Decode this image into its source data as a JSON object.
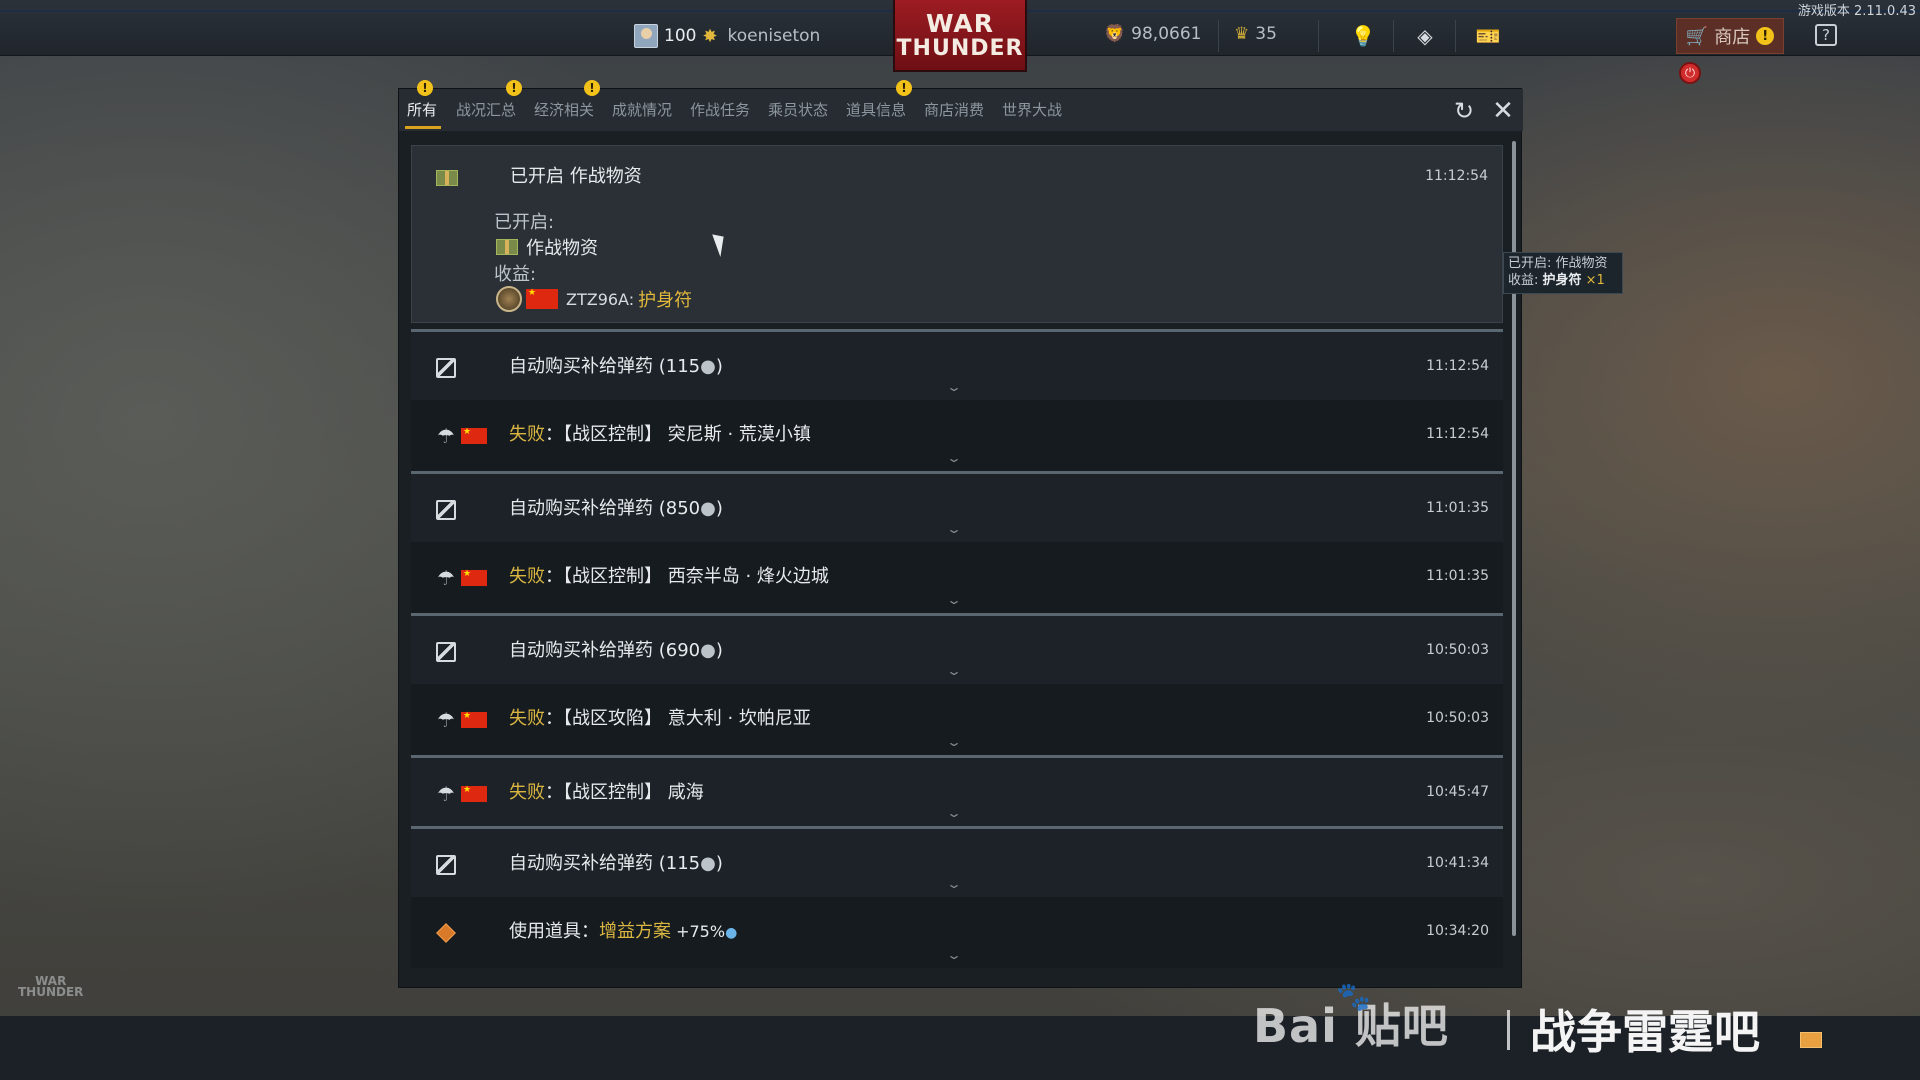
{
  "version_text": "游戏版本 2.11.0.43",
  "player": {
    "rank": "100",
    "name": "koeniseton"
  },
  "logo": {
    "line1": "WAR",
    "line2": "THUNDER"
  },
  "currency": {
    "silver_lions": "98,0661",
    "golden_eagles": "35"
  },
  "shop": {
    "label": "商店"
  },
  "help_label": "?",
  "tabs": [
    {
      "label": "所有",
      "active": true,
      "warn": true
    },
    {
      "label": "战况汇总",
      "warn": true
    },
    {
      "label": "经济相关",
      "warn": true
    },
    {
      "label": "成就情况",
      "warn": false
    },
    {
      "label": "作战任务",
      "warn": false
    },
    {
      "label": "乘员状态",
      "warn": false
    },
    {
      "label": "道具信息",
      "warn": true
    },
    {
      "label": "商店消费",
      "warn": false
    },
    {
      "label": "世界大战",
      "warn": false
    }
  ],
  "warn_glyph": "!",
  "expanded": {
    "title": "已开启 作战物资",
    "time": "11:12:54",
    "opened_label": "已开启:",
    "item_name": "作战物资",
    "income_label": "收益:",
    "vehicle": "ZTZ96A:",
    "reward": "护身符"
  },
  "rows": [
    {
      "type": "purchase",
      "text": "自动购买补给弹药 (115",
      "suffix": ")",
      "time": "11:12:54"
    },
    {
      "type": "battle",
      "fail": "失败",
      "text": "：【战区控制】 突尼斯 · 荒漠小镇",
      "time": "11:12:54"
    },
    {
      "type": "purchase",
      "text": "自动购买补给弹药 (850",
      "suffix": ")",
      "time": "11:01:35"
    },
    {
      "type": "battle",
      "fail": "失败",
      "text": "：【战区控制】 西奈半岛 · 烽火边城",
      "time": "11:01:35"
    },
    {
      "type": "purchase",
      "text": "自动购买补给弹药 (690",
      "suffix": ")",
      "time": "10:50:03"
    },
    {
      "type": "battle",
      "fail": "失败",
      "text": "：【战区攻陷】 意大利 · 坎帕尼亚",
      "time": "10:50:03"
    },
    {
      "type": "battle",
      "fail": "失败",
      "text": "：【战区控制】 咸海",
      "time": "10:45:47"
    },
    {
      "type": "purchase",
      "text": "自动购买补给弹药 (115",
      "suffix": ")",
      "time": "10:41:34"
    },
    {
      "type": "item",
      "prefix": "使用道具：",
      "item": "增益方案",
      "bonus": " +75%",
      "time": "10:34:20"
    }
  ],
  "tooltip": {
    "line1": "已开启: 作战物资",
    "line2_label": "收益: ",
    "line2_item": "护身符",
    "line2_qty": " ×1"
  },
  "watermark": {
    "baidu": "Bai  贴吧",
    "forum": "战争雷霆吧"
  },
  "colors": {
    "accent": "#d9a21f",
    "fail": "#d9b541",
    "warn": "#f2c21a",
    "logo_red": "#9c1c22"
  }
}
